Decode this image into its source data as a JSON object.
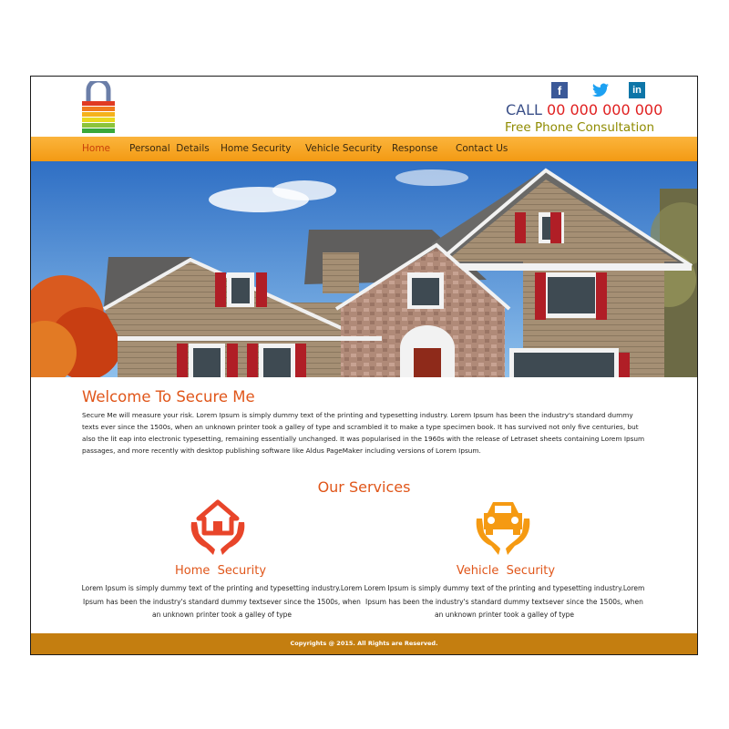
{
  "header": {
    "call_label": "CALL",
    "phone": "00 000 000 000",
    "consultation": "Free Phone Consultation",
    "social": [
      "facebook-icon",
      "twitter-icon",
      "linkedin-icon"
    ]
  },
  "nav": {
    "items": [
      "Home",
      "Personal  Details",
      "Home Security",
      "Vehicle Security",
      "Response",
      "Contact Us"
    ],
    "active": "Home"
  },
  "welcome": {
    "title": "Welcome To Secure Me",
    "text": "Secure Me will measure your risk. Lorem Ipsum is simply dummy text of the printing and typesetting industry. Lorem Ipsum has been the industry's standard dummy texts ever since the 1500s, when an unknown printer took a galley of type and scrambled it to make a type specimen book. It has survived not only five centuries, but also the lit eap into electronic typesetting, remaining essentially unchanged. It was popularised in the 1960s with the release of Letraset sheets containing Lorem Ipsum passages, and more recently with desktop publishing software like Aldus PageMaker including versions of Lorem Ipsum."
  },
  "services": {
    "title": "Our Services",
    "items": [
      {
        "title": "Home  Security",
        "icon": "house-in-hands-icon",
        "text": "Lorem Ipsum is simply dummy text of the printing and typesetting industry.Lorem Ipsum has been the industry's standard dummy textsever since the 1500s, when an unknown printer took a galley of type"
      },
      {
        "title": "Vehicle  Security",
        "icon": "car-in-hands-icon",
        "text": "Lorem Ipsum is simply dummy text of the printing and typesetting industry.Lorem Ipsum has been the industry's standard dummy textsever since the 1500s, when an unknown printer took a galley of type"
      }
    ]
  },
  "footer": {
    "copyright": "Copyrights @ 2015. All Rights are Reserved."
  },
  "colors": {
    "accent": "#e0561a",
    "nav": "#f7a626",
    "footer": "#c47e10",
    "phone": "#e02020",
    "consult": "#8f8b00"
  }
}
